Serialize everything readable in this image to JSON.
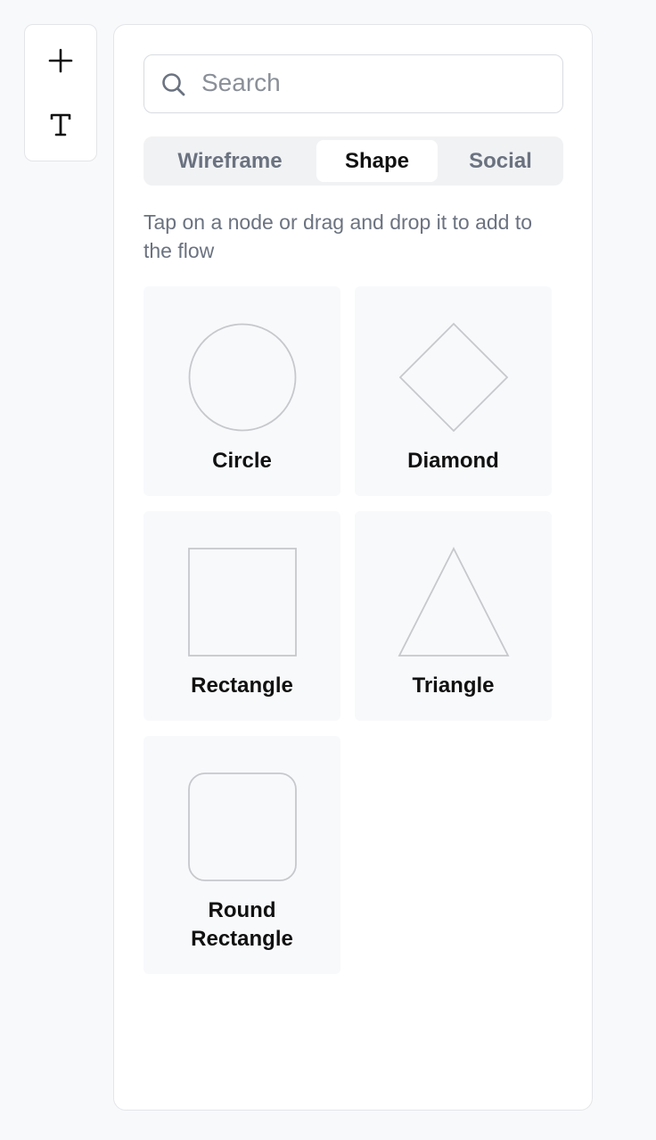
{
  "toolbar": {
    "tools": [
      {
        "name": "add",
        "icon": "plus-icon"
      },
      {
        "name": "text",
        "icon": "text-icon"
      }
    ]
  },
  "search": {
    "placeholder": "Search",
    "value": ""
  },
  "tabs": [
    {
      "label": "Wireframe",
      "active": false
    },
    {
      "label": "Shape",
      "active": true
    },
    {
      "label": "Social",
      "active": false
    }
  ],
  "hint": "Tap on a node or drag and drop it to add to the flow",
  "shapes": [
    {
      "label": "Circle",
      "icon": "circle-shape-icon"
    },
    {
      "label": "Diamond",
      "icon": "diamond-shape-icon"
    },
    {
      "label": "Rectangle",
      "icon": "rectangle-shape-icon"
    },
    {
      "label": "Triangle",
      "icon": "triangle-shape-icon"
    },
    {
      "label": "Round Rectangle",
      "icon": "round-rectangle-shape-icon"
    }
  ],
  "colors": {
    "shape_stroke": "#c6c8cc",
    "active_tab_bg": "#ffffff",
    "tabs_bg": "#f1f2f4"
  }
}
